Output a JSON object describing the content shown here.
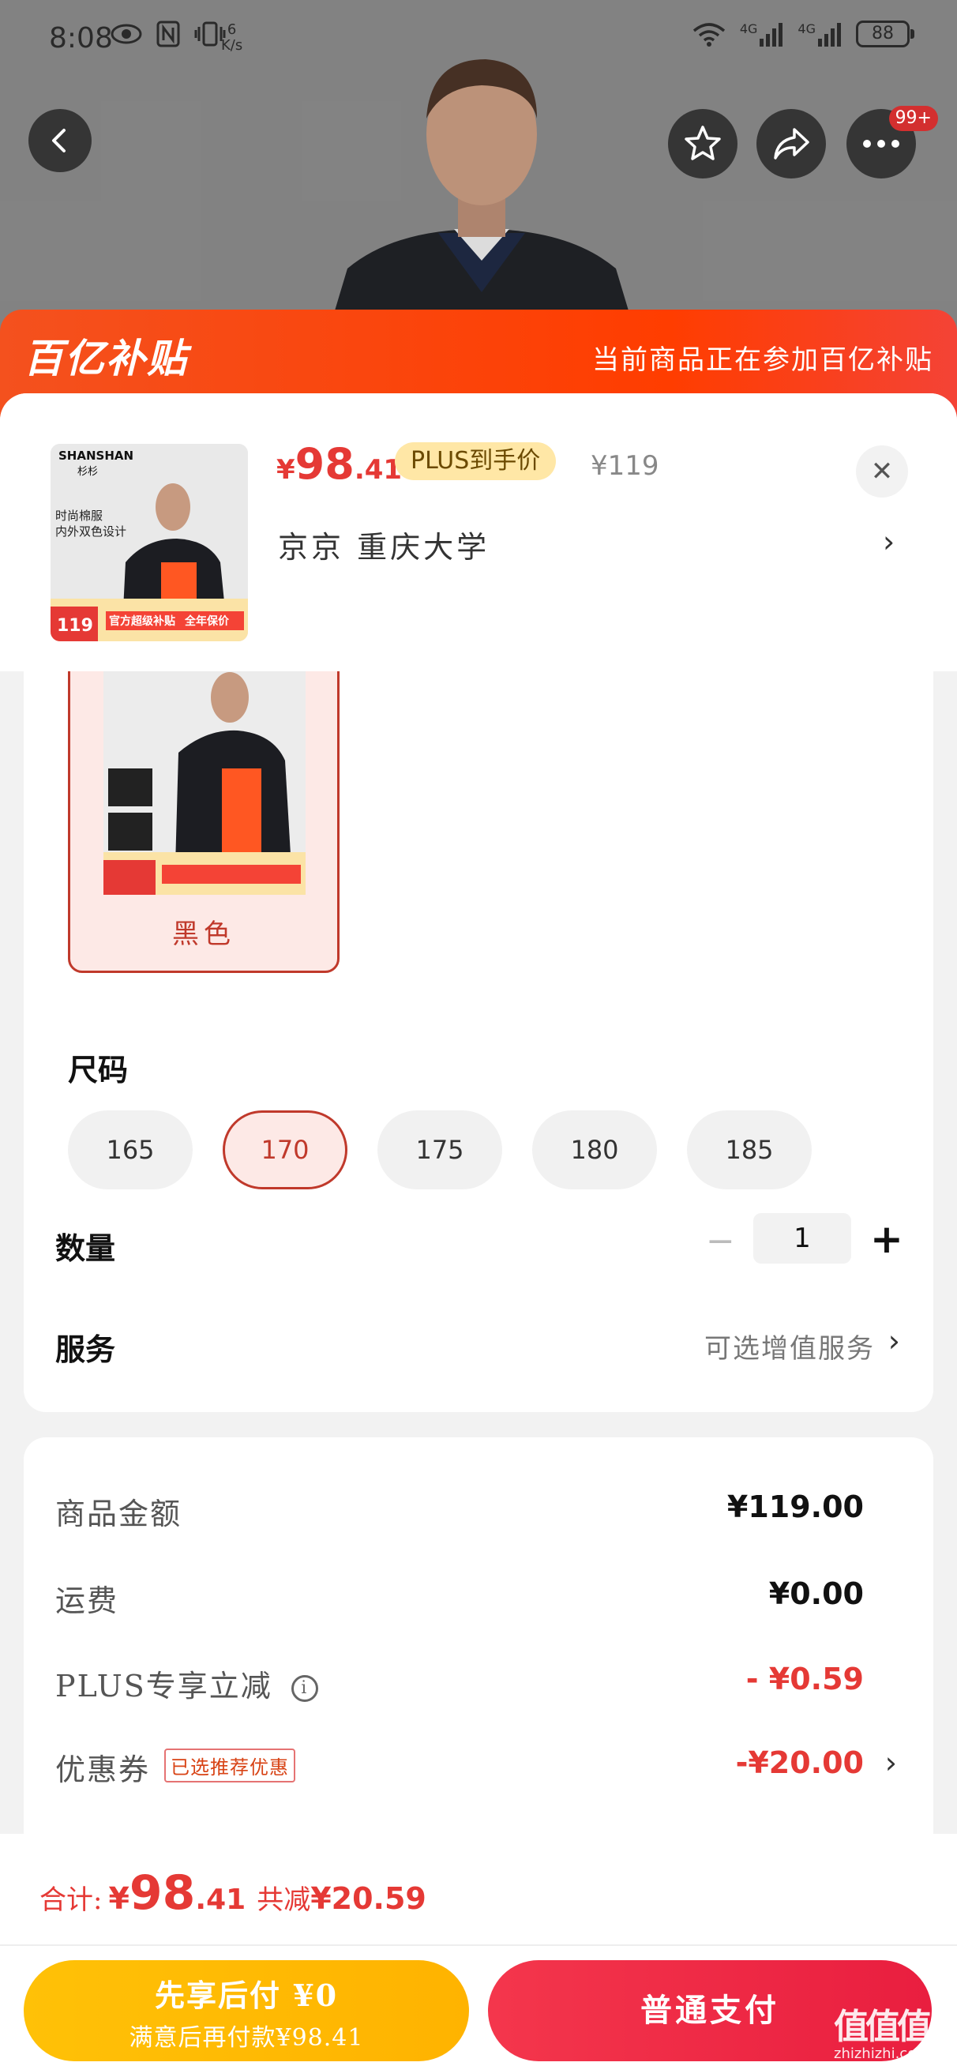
{
  "status_bar": {
    "time": "8:08",
    "speed_value": "6",
    "speed_unit": "K/s",
    "net_1": "4G",
    "net_2": "4G",
    "battery": "88"
  },
  "top_nav": {
    "more_badge": "99+"
  },
  "banner": {
    "logo_text": "百亿补贴",
    "message": "当前商品正在参加百亿补贴"
  },
  "product": {
    "price_symbol": "¥",
    "price_int": "98",
    "price_dec": ".41",
    "plus_tag": "PLUS到手价",
    "original_price": "¥119",
    "close_glyph": "✕",
    "address": "京京  重庆大学",
    "address_chevron": "›",
    "thumb_brand": "SHANSHAN",
    "thumb_brand_cn": "杉杉",
    "thumb_line1": "时尚棉服",
    "thumb_line2": "内外双色设计",
    "thumb_price": "119",
    "thumb_promo_1": "官方超级补贴",
    "thumb_promo_2": "全年保价"
  },
  "spec": {
    "color_label": "黑色",
    "size_title": "尺码",
    "sizes": [
      "165",
      "170",
      "175",
      "180",
      "185"
    ],
    "selected_size": "170",
    "qty_title": "数量",
    "qty_minus": "−",
    "qty_value": "1",
    "qty_plus": "+",
    "service_title": "服务",
    "service_value": "可选增值服务",
    "service_chevron": "›"
  },
  "costs": {
    "goods_label": "商品金额",
    "goods_value": "¥119.00",
    "shipping_label": "运费",
    "shipping_value": "¥0.00",
    "plus_label": "PLUS专享立减",
    "plus_info": "i",
    "plus_value": "- ¥0.59",
    "coupon_label": "优惠券",
    "coupon_tag": "已选推荐优惠",
    "coupon_value": "-¥20.00",
    "coupon_chevron": "›"
  },
  "bottom": {
    "total_label": "合计:",
    "total_symbol": "¥",
    "total_int": "98",
    "total_dec": ".41",
    "save_label": "共减",
    "save_value": "¥20.59",
    "later_line1": "先享后付 ¥0",
    "later_line2": "满意后再付款¥98.41",
    "pay_label": "普通支付"
  },
  "watermark": {
    "mark": "值值值",
    "site": "zhizhizhi.com"
  },
  "colors": {
    "accent_red": "#e53935",
    "banner_orange": "#ff3d00",
    "later_yellow": "#ffc107",
    "pay_red": "#f4364c"
  }
}
